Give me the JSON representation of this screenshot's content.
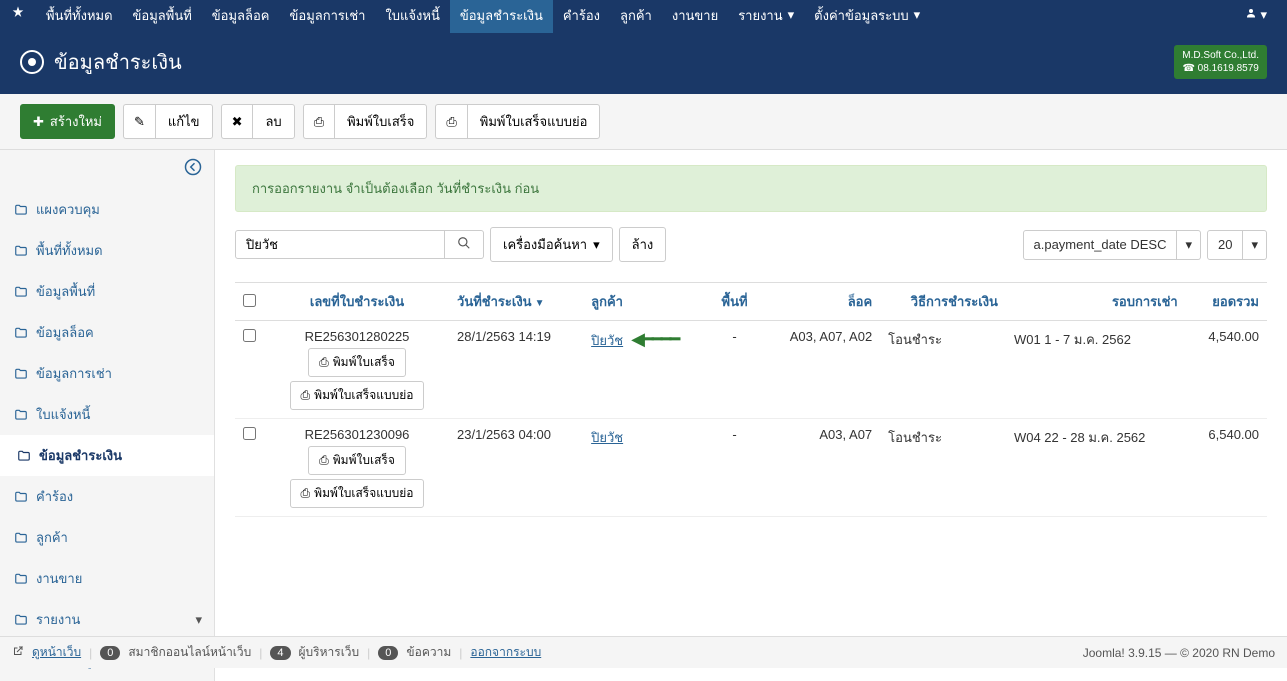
{
  "topnav": {
    "items": [
      "พื้นที่ทั้งหมด",
      "ข้อมูลพื้นที่",
      "ข้อมูลล็อค",
      "ข้อมูลการเช่า",
      "ใบแจ้งหนี้",
      "ข้อมูลชำระเงิน",
      "คำร้อง",
      "ลูกค้า",
      "งานขาย",
      "รายงาน",
      "ตั้งค่าข้อมูลระบบ"
    ],
    "active_index": 5
  },
  "header": {
    "title": "ข้อมูลชำระเงิน",
    "badge_line1": "M.D.Soft Co.,Ltd.",
    "badge_line2": "☎ 08.1619.8579"
  },
  "toolbar": {
    "new": "สร้างใหม่",
    "edit": "แก้ไข",
    "delete": "ลบ",
    "print": "พิมพ์ใบเสร็จ",
    "print_short": "พิมพ์ใบเสร็จแบบย่อ"
  },
  "sidebar": {
    "items": [
      {
        "label": "แผงควบคุม",
        "has_caret": false
      },
      {
        "label": "พื้นที่ทั้งหมด",
        "has_caret": false
      },
      {
        "label": "ข้อมูลพื้นที่",
        "has_caret": false
      },
      {
        "label": "ข้อมูลล็อค",
        "has_caret": false
      },
      {
        "label": "ข้อมูลการเช่า",
        "has_caret": false
      },
      {
        "label": "ใบแจ้งหนี้",
        "has_caret": false
      },
      {
        "label": "ข้อมูลชำระเงิน",
        "has_caret": false
      },
      {
        "label": "คำร้อง",
        "has_caret": false
      },
      {
        "label": "ลูกค้า",
        "has_caret": false
      },
      {
        "label": "งานขาย",
        "has_caret": false
      },
      {
        "label": "รายงาน",
        "has_caret": true
      },
      {
        "label": "ตั้งค่าข้อมูลระบบ",
        "has_caret": true
      }
    ],
    "active_index": 6
  },
  "alert": "การออกรายงาน จำเป็นต้องเลือก วันที่ชำระเงิน ก่อน",
  "search": {
    "value": "ปิยวัช",
    "tools": "เครื่องมือค้นหา",
    "clear": "ล้าง",
    "sort": "a.payment_date DESC",
    "limit": "20"
  },
  "columns": {
    "receipt_no": "เลขที่ใบชำระเงิน",
    "payment_date": "วันที่ชำระเงิน",
    "customer": "ลูกค้า",
    "area": "พื้นที่",
    "lock": "ล็อค",
    "method": "วิธีการชำระเงิน",
    "period": "รอบการเช่า",
    "total": "ยอดรวม"
  },
  "rows": [
    {
      "receipt_no": "RE256301280225",
      "date": "28/1/2563 14:19",
      "customer": "ปิยวัช",
      "area": "-",
      "lock": "A03, A07, A02",
      "method": "โอนชำระ",
      "period": "W01 1 - 7 ม.ค. 2562",
      "total": "4,540.00",
      "highlight": true
    },
    {
      "receipt_no": "RE256301230096",
      "date": "23/1/2563 04:00",
      "customer": "ปิยวัช",
      "area": "-",
      "lock": "A03, A07",
      "method": "โอนชำระ",
      "period": "W04 22 - 28 ม.ค. 2562",
      "total": "6,540.00",
      "highlight": false
    }
  ],
  "row_buttons": {
    "print": "พิมพ์ใบเสร็จ",
    "print_short": "พิมพ์ใบเสร็จแบบย่อ"
  },
  "footer": {
    "view_site": "ดูหน้าเว็บ",
    "online_count": "0",
    "online_label": "สมาชิกออนไลน์หน้าเว็บ",
    "admin_count": "4",
    "admin_label": "ผู้บริหารเว็บ",
    "msg_count": "0",
    "msg_label": "ข้อความ",
    "logout": "ออกจากระบบ",
    "right": "Joomla! 3.9.15  —  © 2020 RN Demo"
  }
}
